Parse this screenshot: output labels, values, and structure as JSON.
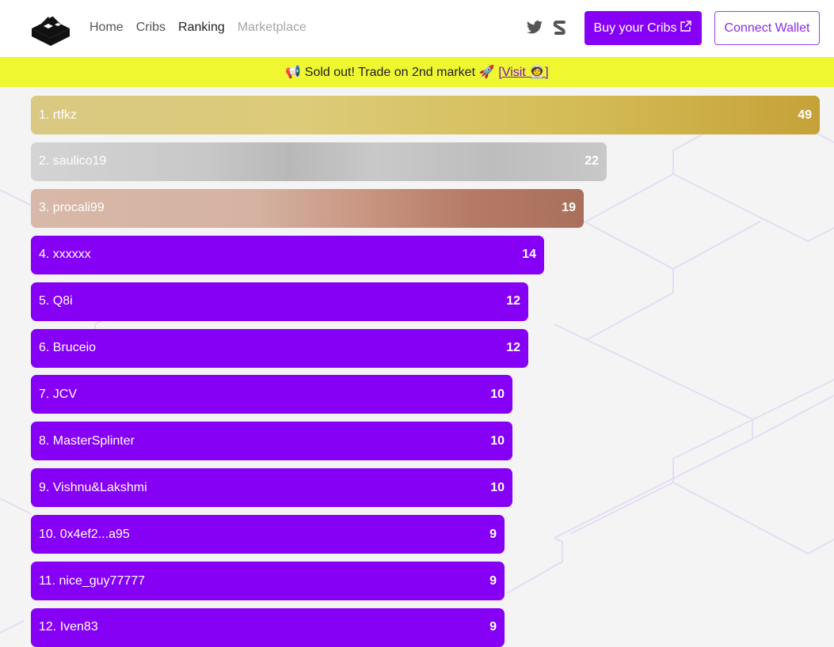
{
  "header": {
    "nav": [
      {
        "label": "Home"
      },
      {
        "label": "Cribs"
      },
      {
        "label": "Ranking"
      },
      {
        "label": "Marketplace"
      }
    ],
    "buy_label": "Buy your Cribs",
    "wallet_label": "Connect Wallet",
    "accent": "#8500f5"
  },
  "banner": {
    "text": "📢 Sold out! Trade on 2nd market 🚀",
    "link_label": "[Visit 🧑‍🚀]",
    "background": "#eff731"
  },
  "ranking": [
    {
      "label": "1. rtfkz",
      "score": "49",
      "value": 49,
      "style": "gold"
    },
    {
      "label": "2. saulico19",
      "score": "22",
      "value": 22,
      "style": "silver"
    },
    {
      "label": "3. procali99",
      "score": "19",
      "value": 19,
      "style": "bronze"
    },
    {
      "label": "4. xxxxxx",
      "score": "14",
      "value": 14,
      "style": "purple"
    },
    {
      "label": "5. Q8i",
      "score": "12",
      "value": 12,
      "style": "purple"
    },
    {
      "label": "6. Bruceio",
      "score": "12",
      "value": 12,
      "style": "purple"
    },
    {
      "label": "7. JCV",
      "score": "10",
      "value": 10,
      "style": "purple"
    },
    {
      "label": "8. MasterSplinter",
      "score": "10",
      "value": 10,
      "style": "purple"
    },
    {
      "label": "9. Vishnu&Lakshmi",
      "score": "10",
      "value": 10,
      "style": "purple"
    },
    {
      "label": "10. 0x4ef2...a95",
      "score": "9",
      "value": 9,
      "style": "purple"
    },
    {
      "label": "11. nice_guy77777",
      "score": "9",
      "value": 9,
      "style": "purple"
    },
    {
      "label": "12. Iven83",
      "score": "9",
      "value": 9,
      "style": "purple"
    }
  ]
}
